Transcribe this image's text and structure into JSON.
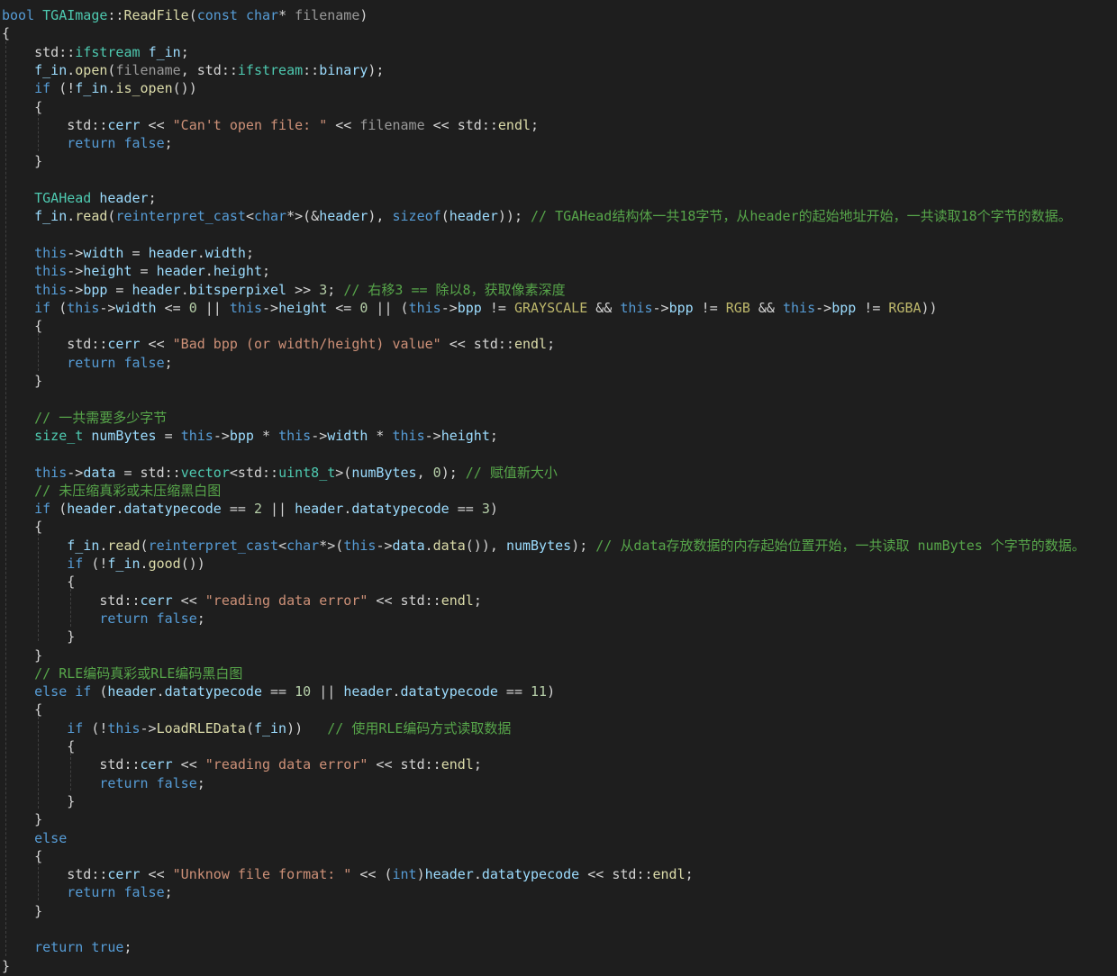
{
  "editor": {
    "language": "cpp",
    "colors": {
      "background": "#1e1e1e",
      "keyword": "#569cd6",
      "type": "#4ec9b0",
      "function": "#dcdcaa",
      "variable": "#9cdcfe",
      "parameter": "#9a9a9a",
      "string": "#ce9178",
      "number": "#b5cea8",
      "comment": "#57a64a",
      "macro": "#bdb76b",
      "plain": "#d4d4d4"
    },
    "lines": [
      [
        [
          "kw",
          "bool "
        ],
        [
          "ty",
          "TGAImage"
        ],
        [
          "op",
          "::"
        ],
        [
          "fn",
          "ReadFile"
        ],
        [
          "op",
          "("
        ],
        [
          "kw",
          "const "
        ],
        [
          "kw",
          "char"
        ],
        [
          "op",
          "* "
        ],
        [
          "par",
          "filename"
        ],
        [
          "op",
          ")"
        ]
      ],
      [
        [
          "op",
          "{"
        ]
      ],
      [
        [
          "op",
          "    "
        ],
        [
          "ns",
          "std"
        ],
        [
          "op",
          "::"
        ],
        [
          "ty",
          "ifstream "
        ],
        [
          "var",
          "f_in"
        ],
        [
          "op",
          ";"
        ]
      ],
      [
        [
          "op",
          "    "
        ],
        [
          "var",
          "f_in"
        ],
        [
          "op",
          "."
        ],
        [
          "fn",
          "open"
        ],
        [
          "op",
          "("
        ],
        [
          "par",
          "filename"
        ],
        [
          "op",
          ", "
        ],
        [
          "ns",
          "std"
        ],
        [
          "op",
          "::"
        ],
        [
          "ty",
          "ifstream"
        ],
        [
          "op",
          "::"
        ],
        [
          "var",
          "binary"
        ],
        [
          "op",
          ");"
        ]
      ],
      [
        [
          "op",
          "    "
        ],
        [
          "kw",
          "if "
        ],
        [
          "op",
          "(!"
        ],
        [
          "var",
          "f_in"
        ],
        [
          "op",
          "."
        ],
        [
          "fn",
          "is_open"
        ],
        [
          "op",
          "())"
        ]
      ],
      [
        [
          "op",
          "    {"
        ]
      ],
      [
        [
          "op",
          "        "
        ],
        [
          "ns",
          "std"
        ],
        [
          "op",
          "::"
        ],
        [
          "var",
          "cerr"
        ],
        [
          "op",
          " << "
        ],
        [
          "str",
          "\"Can't open file: \""
        ],
        [
          "op",
          " << "
        ],
        [
          "par",
          "filename"
        ],
        [
          "op",
          " << "
        ],
        [
          "ns",
          "std"
        ],
        [
          "op",
          "::"
        ],
        [
          "fn",
          "endl"
        ],
        [
          "op",
          ";"
        ]
      ],
      [
        [
          "op",
          "        "
        ],
        [
          "kw",
          "return "
        ],
        [
          "kw",
          "false"
        ],
        [
          "op",
          ";"
        ]
      ],
      [
        [
          "op",
          "    }"
        ]
      ],
      [],
      [
        [
          "op",
          "    "
        ],
        [
          "ty",
          "TGAHead "
        ],
        [
          "var",
          "header"
        ],
        [
          "op",
          ";"
        ]
      ],
      [
        [
          "op",
          "    "
        ],
        [
          "var",
          "f_in"
        ],
        [
          "op",
          "."
        ],
        [
          "fn",
          "read"
        ],
        [
          "op",
          "("
        ],
        [
          "kw",
          "reinterpret_cast"
        ],
        [
          "op",
          "<"
        ],
        [
          "kw",
          "char"
        ],
        [
          "op",
          "*>(&"
        ],
        [
          "var",
          "header"
        ],
        [
          "op",
          "), "
        ],
        [
          "kw",
          "sizeof"
        ],
        [
          "op",
          "("
        ],
        [
          "var",
          "header"
        ],
        [
          "op",
          "));"
        ],
        [
          "cm",
          " // TGAHead结构体一共18字节，从header的起始地址开始，一共读取18个字节的数据。"
        ]
      ],
      [],
      [
        [
          "op",
          "    "
        ],
        [
          "kw",
          "this"
        ],
        [
          "op",
          "->"
        ],
        [
          "var",
          "width"
        ],
        [
          "op",
          " = "
        ],
        [
          "var",
          "header"
        ],
        [
          "op",
          "."
        ],
        [
          "var",
          "width"
        ],
        [
          "op",
          ";"
        ]
      ],
      [
        [
          "op",
          "    "
        ],
        [
          "kw",
          "this"
        ],
        [
          "op",
          "->"
        ],
        [
          "var",
          "height"
        ],
        [
          "op",
          " = "
        ],
        [
          "var",
          "header"
        ],
        [
          "op",
          "."
        ],
        [
          "var",
          "height"
        ],
        [
          "op",
          ";"
        ]
      ],
      [
        [
          "op",
          "    "
        ],
        [
          "kw",
          "this"
        ],
        [
          "op",
          "->"
        ],
        [
          "var",
          "bpp"
        ],
        [
          "op",
          " = "
        ],
        [
          "var",
          "header"
        ],
        [
          "op",
          "."
        ],
        [
          "var",
          "bitsperpixel"
        ],
        [
          "op",
          " >> "
        ],
        [
          "num",
          "3"
        ],
        [
          "op",
          "; "
        ],
        [
          "cm",
          "// 右移3 == 除以8，获取像素深度"
        ]
      ],
      [
        [
          "op",
          "    "
        ],
        [
          "kw",
          "if "
        ],
        [
          "op",
          "("
        ],
        [
          "kw",
          "this"
        ],
        [
          "op",
          "->"
        ],
        [
          "var",
          "width"
        ],
        [
          "op",
          " <= "
        ],
        [
          "num",
          "0"
        ],
        [
          "op",
          " || "
        ],
        [
          "kw",
          "this"
        ],
        [
          "op",
          "->"
        ],
        [
          "var",
          "height"
        ],
        [
          "op",
          " <= "
        ],
        [
          "num",
          "0"
        ],
        [
          "op",
          " || ("
        ],
        [
          "kw",
          "this"
        ],
        [
          "op",
          "->"
        ],
        [
          "var",
          "bpp"
        ],
        [
          "op",
          " != "
        ],
        [
          "mac",
          "GRAYSCALE"
        ],
        [
          "op",
          " && "
        ],
        [
          "kw",
          "this"
        ],
        [
          "op",
          "->"
        ],
        [
          "var",
          "bpp"
        ],
        [
          "op",
          " != "
        ],
        [
          "mac",
          "RGB"
        ],
        [
          "op",
          " && "
        ],
        [
          "kw",
          "this"
        ],
        [
          "op",
          "->"
        ],
        [
          "var",
          "bpp"
        ],
        [
          "op",
          " != "
        ],
        [
          "mac",
          "RGBA"
        ],
        [
          "op",
          "))"
        ]
      ],
      [
        [
          "op",
          "    {"
        ]
      ],
      [
        [
          "op",
          "        "
        ],
        [
          "ns",
          "std"
        ],
        [
          "op",
          "::"
        ],
        [
          "var",
          "cerr"
        ],
        [
          "op",
          " << "
        ],
        [
          "str",
          "\"Bad bpp (or width/height) value\""
        ],
        [
          "op",
          " << "
        ],
        [
          "ns",
          "std"
        ],
        [
          "op",
          "::"
        ],
        [
          "fn",
          "endl"
        ],
        [
          "op",
          ";"
        ]
      ],
      [
        [
          "op",
          "        "
        ],
        [
          "kw",
          "return "
        ],
        [
          "kw",
          "false"
        ],
        [
          "op",
          ";"
        ]
      ],
      [
        [
          "op",
          "    }"
        ]
      ],
      [],
      [
        [
          "op",
          "    "
        ],
        [
          "cm",
          "// 一共需要多少字节"
        ]
      ],
      [
        [
          "op",
          "    "
        ],
        [
          "ty",
          "size_t "
        ],
        [
          "var",
          "numBytes"
        ],
        [
          "op",
          " = "
        ],
        [
          "kw",
          "this"
        ],
        [
          "op",
          "->"
        ],
        [
          "var",
          "bpp"
        ],
        [
          "op",
          " * "
        ],
        [
          "kw",
          "this"
        ],
        [
          "op",
          "->"
        ],
        [
          "var",
          "width"
        ],
        [
          "op",
          " * "
        ],
        [
          "kw",
          "this"
        ],
        [
          "op",
          "->"
        ],
        [
          "var",
          "height"
        ],
        [
          "op",
          ";"
        ]
      ],
      [],
      [
        [
          "op",
          "    "
        ],
        [
          "kw",
          "this"
        ],
        [
          "op",
          "->"
        ],
        [
          "var",
          "data"
        ],
        [
          "op",
          " = "
        ],
        [
          "ns",
          "std"
        ],
        [
          "op",
          "::"
        ],
        [
          "ty",
          "vector"
        ],
        [
          "op",
          "<"
        ],
        [
          "ns",
          "std"
        ],
        [
          "op",
          "::"
        ],
        [
          "ty",
          "uint8_t"
        ],
        [
          "op",
          ">("
        ],
        [
          "var",
          "numBytes"
        ],
        [
          "op",
          ", "
        ],
        [
          "num",
          "0"
        ],
        [
          "op",
          "); "
        ],
        [
          "cm",
          "// 赋值新大小"
        ]
      ],
      [
        [
          "op",
          "    "
        ],
        [
          "cm",
          "// 未压缩真彩或未压缩黑白图"
        ]
      ],
      [
        [
          "op",
          "    "
        ],
        [
          "kw",
          "if "
        ],
        [
          "op",
          "("
        ],
        [
          "var",
          "header"
        ],
        [
          "op",
          "."
        ],
        [
          "var",
          "datatypecode"
        ],
        [
          "op",
          " == "
        ],
        [
          "num",
          "2"
        ],
        [
          "op",
          " || "
        ],
        [
          "var",
          "header"
        ],
        [
          "op",
          "."
        ],
        [
          "var",
          "datatypecode"
        ],
        [
          "op",
          " == "
        ],
        [
          "num",
          "3"
        ],
        [
          "op",
          ")"
        ]
      ],
      [
        [
          "op",
          "    {"
        ]
      ],
      [
        [
          "op",
          "        "
        ],
        [
          "var",
          "f_in"
        ],
        [
          "op",
          "."
        ],
        [
          "fn",
          "read"
        ],
        [
          "op",
          "("
        ],
        [
          "kw",
          "reinterpret_cast"
        ],
        [
          "op",
          "<"
        ],
        [
          "kw",
          "char"
        ],
        [
          "op",
          "*>("
        ],
        [
          "kw",
          "this"
        ],
        [
          "op",
          "->"
        ],
        [
          "var",
          "data"
        ],
        [
          "op",
          "."
        ],
        [
          "fn",
          "data"
        ],
        [
          "op",
          "()), "
        ],
        [
          "var",
          "numBytes"
        ],
        [
          "op",
          "); "
        ],
        [
          "cm",
          "// 从data存放数据的内存起始位置开始，一共读取 numBytes 个字节的数据。"
        ]
      ],
      [
        [
          "op",
          "        "
        ],
        [
          "kw",
          "if "
        ],
        [
          "op",
          "(!"
        ],
        [
          "var",
          "f_in"
        ],
        [
          "op",
          "."
        ],
        [
          "fn",
          "good"
        ],
        [
          "op",
          "())"
        ]
      ],
      [
        [
          "op",
          "        {"
        ]
      ],
      [
        [
          "op",
          "            "
        ],
        [
          "ns",
          "std"
        ],
        [
          "op",
          "::"
        ],
        [
          "var",
          "cerr"
        ],
        [
          "op",
          " << "
        ],
        [
          "str",
          "\"reading data error\""
        ],
        [
          "op",
          " << "
        ],
        [
          "ns",
          "std"
        ],
        [
          "op",
          "::"
        ],
        [
          "fn",
          "endl"
        ],
        [
          "op",
          ";"
        ]
      ],
      [
        [
          "op",
          "            "
        ],
        [
          "kw",
          "return "
        ],
        [
          "kw",
          "false"
        ],
        [
          "op",
          ";"
        ]
      ],
      [
        [
          "op",
          "        }"
        ]
      ],
      [
        [
          "op",
          "    }"
        ]
      ],
      [
        [
          "op",
          "    "
        ],
        [
          "cm",
          "// RLE编码真彩或RLE编码黑白图"
        ]
      ],
      [
        [
          "op",
          "    "
        ],
        [
          "kw",
          "else if "
        ],
        [
          "op",
          "("
        ],
        [
          "var",
          "header"
        ],
        [
          "op",
          "."
        ],
        [
          "var",
          "datatypecode"
        ],
        [
          "op",
          " == "
        ],
        [
          "num",
          "10"
        ],
        [
          "op",
          " || "
        ],
        [
          "var",
          "header"
        ],
        [
          "op",
          "."
        ],
        [
          "var",
          "datatypecode"
        ],
        [
          "op",
          " == "
        ],
        [
          "num",
          "11"
        ],
        [
          "op",
          ")"
        ]
      ],
      [
        [
          "op",
          "    {"
        ]
      ],
      [
        [
          "op",
          "        "
        ],
        [
          "kw",
          "if "
        ],
        [
          "op",
          "(!"
        ],
        [
          "kw",
          "this"
        ],
        [
          "op",
          "->"
        ],
        [
          "fn",
          "LoadRLEData"
        ],
        [
          "op",
          "("
        ],
        [
          "var",
          "f_in"
        ],
        [
          "op",
          "))   "
        ],
        [
          "cm",
          "// 使用RLE编码方式读取数据"
        ]
      ],
      [
        [
          "op",
          "        {"
        ]
      ],
      [
        [
          "op",
          "            "
        ],
        [
          "ns",
          "std"
        ],
        [
          "op",
          "::"
        ],
        [
          "var",
          "cerr"
        ],
        [
          "op",
          " << "
        ],
        [
          "str",
          "\"reading data error\""
        ],
        [
          "op",
          " << "
        ],
        [
          "ns",
          "std"
        ],
        [
          "op",
          "::"
        ],
        [
          "fn",
          "endl"
        ],
        [
          "op",
          ";"
        ]
      ],
      [
        [
          "op",
          "            "
        ],
        [
          "kw",
          "return "
        ],
        [
          "kw",
          "false"
        ],
        [
          "op",
          ";"
        ]
      ],
      [
        [
          "op",
          "        }"
        ]
      ],
      [
        [
          "op",
          "    }"
        ]
      ],
      [
        [
          "op",
          "    "
        ],
        [
          "kw",
          "else"
        ]
      ],
      [
        [
          "op",
          "    {"
        ]
      ],
      [
        [
          "op",
          "        "
        ],
        [
          "ns",
          "std"
        ],
        [
          "op",
          "::"
        ],
        [
          "var",
          "cerr"
        ],
        [
          "op",
          " << "
        ],
        [
          "str",
          "\"Unknow file format: \""
        ],
        [
          "op",
          " << ("
        ],
        [
          "kw",
          "int"
        ],
        [
          "op",
          ")"
        ],
        [
          "var",
          "header"
        ],
        [
          "op",
          "."
        ],
        [
          "var",
          "datatypecode"
        ],
        [
          "op",
          " << "
        ],
        [
          "ns",
          "std"
        ],
        [
          "op",
          "::"
        ],
        [
          "fn",
          "endl"
        ],
        [
          "op",
          ";"
        ]
      ],
      [
        [
          "op",
          "        "
        ],
        [
          "kw",
          "return "
        ],
        [
          "kw",
          "false"
        ],
        [
          "op",
          ";"
        ]
      ],
      [
        [
          "op",
          "    }"
        ]
      ],
      [],
      [
        [
          "op",
          "    "
        ],
        [
          "kw",
          "return "
        ],
        [
          "kw",
          "true"
        ],
        [
          "op",
          ";"
        ]
      ],
      [
        [
          "op",
          "}"
        ]
      ]
    ]
  }
}
